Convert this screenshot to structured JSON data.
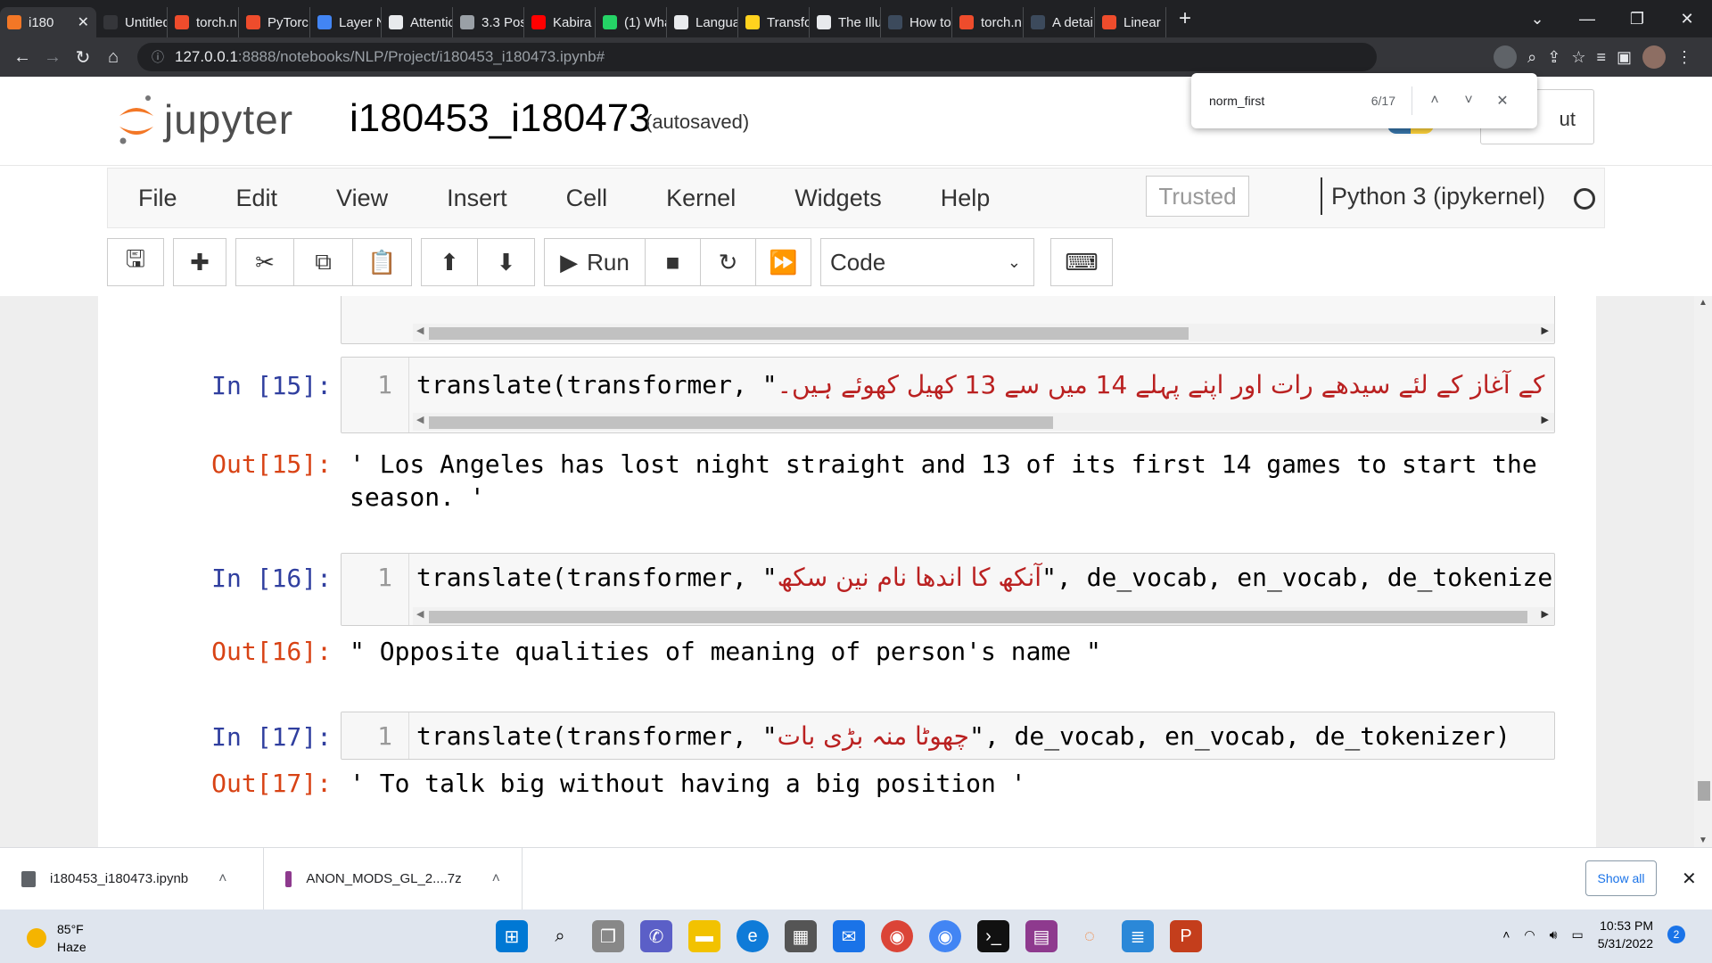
{
  "browser": {
    "tabs": [
      {
        "label": "i180",
        "active": true,
        "color": "#f37726"
      },
      {
        "label": "Untitled",
        "color": "#35363a"
      },
      {
        "label": "torch.n",
        "color": "#ee4c2c"
      },
      {
        "label": "PyTorc",
        "color": "#ee4c2c"
      },
      {
        "label": "Layer N",
        "color": "#4285f4"
      },
      {
        "label": "Attentio",
        "color": "#e8eaed"
      },
      {
        "label": "3.3 Pos",
        "color": "#9aa0a6"
      },
      {
        "label": "Kabira",
        "color": "#ff0000"
      },
      {
        "label": "(1) Wha",
        "color": "#25d366"
      },
      {
        "label": "Langua",
        "color": "#e8eaed"
      },
      {
        "label": "Transfo",
        "color": "#ffd21e"
      },
      {
        "label": "The Illu",
        "color": "#e8eaed"
      },
      {
        "label": "How to",
        "color": "#3c4a5c"
      },
      {
        "label": "torch.n",
        "color": "#ee4c2c"
      },
      {
        "label": "A detai",
        "color": "#3c4a5c"
      },
      {
        "label": "Linear",
        "color": "#ee4c2c"
      }
    ],
    "url_host": "127.0.0.1",
    "url_path": ":8888/notebooks/NLP/Project/i180453_i180473.ipynb#"
  },
  "find": {
    "query": "norm_first",
    "count": "6/17"
  },
  "jupyter": {
    "logo_text": "jupyter",
    "notebook_name": "i180453_i180473",
    "autosave": "(autosaved)",
    "logout_partial": "ut",
    "menu": [
      "File",
      "Edit",
      "View",
      "Insert",
      "Cell",
      "Kernel",
      "Widgets",
      "Help"
    ],
    "trusted": "Trusted",
    "kernel": "Python 3 (ipykernel)",
    "run_label": "Run",
    "cell_type": "Code"
  },
  "cells": {
    "c15": {
      "in_prompt": "In [15]:",
      "line": "1",
      "code_prefix": "translate(transformer, \"",
      "urdu": "لاس اینجلس نے سیزن کے آغاز کے لئے سیدھے رات اور اپنے پہلے 14 میں سے 13 کھیل کھوئے ہیں۔",
      "out_prompt": "Out[15]:",
      "output": "' Los Angeles has lost night straight and 13 of its first 14 games to start the season. '"
    },
    "c16": {
      "in_prompt": "In [16]:",
      "line": "1",
      "code_prefix": "translate(transformer, \"",
      "urdu": "آنکھ کا اندھا نام نین سکھ",
      "code_suffix": "\", de_vocab, en_vocab, de_tokenizer",
      "out_prompt": "Out[16]:",
      "output": "\" Opposite qualities of meaning of person's name \""
    },
    "c17": {
      "in_prompt": "In [17]:",
      "line": "1",
      "code_prefix": "translate(transformer, \"",
      "urdu": "چھوٹا منہ بڑی بات",
      "code_suffix": "\", de_vocab, en_vocab, de_tokenizer)",
      "out_prompt": "Out[17]:",
      "output": "' To talk big without having a big position '"
    }
  },
  "downloads": [
    {
      "name": "i180453_i180473.ipynb"
    },
    {
      "name": "ANON_MODS_GL_2....7z"
    }
  ],
  "show_all": "Show all",
  "taskbar": {
    "temp": "85°F",
    "weather": "Haze",
    "time": "10:53 PM",
    "date": "5/31/2022",
    "notif": "2"
  }
}
